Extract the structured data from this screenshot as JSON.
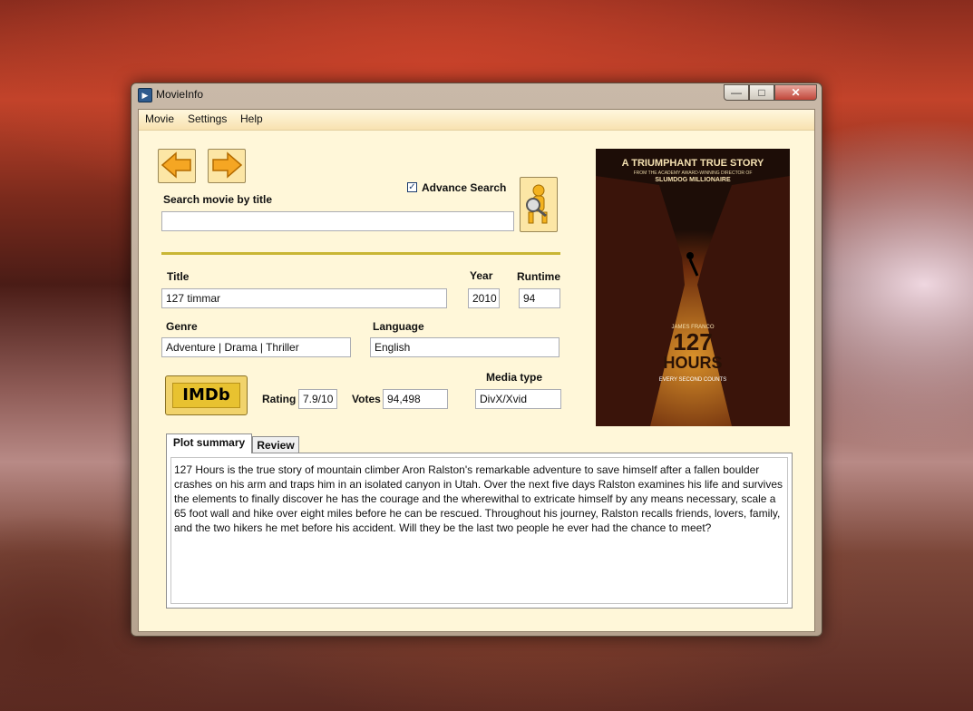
{
  "window": {
    "title": "MovieInfo",
    "close_symbol": "✕",
    "min_symbol": "—",
    "max_symbol": "□"
  },
  "menu": [
    "Movie",
    "Settings",
    "Help"
  ],
  "search": {
    "label": "Search movie by title",
    "value": "",
    "advance_search_label": "Advance Search",
    "advance_search_checked": true,
    "checkmark": "✓"
  },
  "details": {
    "title_label": "Title",
    "title_value": "127 timmar",
    "year_label": "Year",
    "year_value": "2010",
    "runtime_label": "Runtime",
    "runtime_value": "94",
    "genre_label": "Genre",
    "genre_value": "Adventure | Drama | Thriller",
    "language_label": "Language",
    "language_value": "English",
    "imdb_logo_text": "IMDb",
    "rating_label": "Rating",
    "rating_value": "7.9/10",
    "votes_label": "Votes",
    "votes_value": "94,498",
    "media_type_label": "Media type",
    "media_type_value": "DivX/Xvid"
  },
  "poster": {
    "tagline": "A TRIUMPHANT TRUE STORY",
    "subline": "FROM THE ACADEMY AWARD-WINNING DIRECTOR OF",
    "director_film": "SLUMDOG MILLIONAIRE",
    "actor": "JAMES FRANCO",
    "title_line1": "127",
    "title_line2": "HOURS",
    "tagline2": "EVERY SECOND COUNTS"
  },
  "tabs": [
    {
      "label": "Plot summary",
      "active": true
    },
    {
      "label": "Review",
      "active": false
    }
  ],
  "plot_summary": "127 Hours is the true story of mountain climber Aron Ralston's remarkable adventure to save himself after a fallen boulder crashes on his arm and traps him in an isolated canyon in Utah. Over the next five days Ralston examines his life and survives the elements to finally discover he has the courage and the wherewithal to extricate himself by any means necessary, scale a 65 foot wall and hike over eight miles before he can be rescued. Throughout his journey, Ralston recalls friends, lovers, family, and the two hikers he met before his accident. Will they be the last two people he ever had the chance to meet?",
  "colors": {
    "client_bg": "#fff7d9",
    "divider": "#c9b634",
    "button_bg": "#fce6a5",
    "arrow": "#f5a623"
  }
}
